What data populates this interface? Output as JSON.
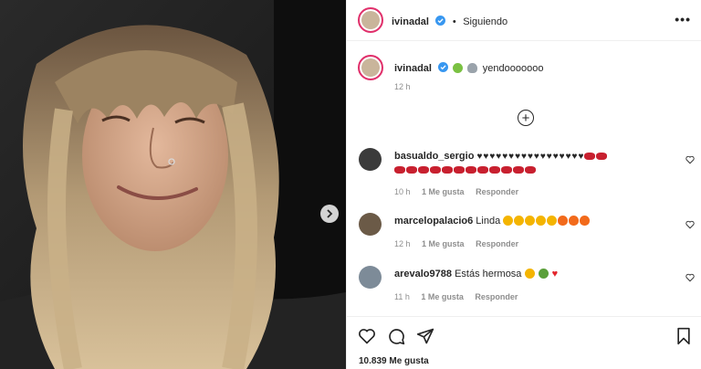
{
  "post": {
    "username": "ivinadal",
    "follow_status": "Siguiendo",
    "more_label": "•••",
    "caption_text": "yendooooooo",
    "caption_emojis": [
      "alien-emoji",
      "ufo-emoji"
    ],
    "caption_time": "12 h",
    "likes": "10.839 Me gusta"
  },
  "comments": [
    {
      "username": "basualdo_sergio",
      "line1_hearts": 17,
      "line1_lips": 2,
      "line2_lips": 12,
      "time": "10 h",
      "likes": "1 Me gusta",
      "reply": "Responder"
    },
    {
      "username": "marcelopalacio6",
      "text": "Linda",
      "stars": 5,
      "fires": 3,
      "time": "12 h",
      "likes": "1 Me gusta",
      "reply": "Responder"
    },
    {
      "username": "arevalo9788",
      "text": "Estás hermosa",
      "emojis": [
        "heart-eyes-emoji",
        "broccoli-emoji",
        "red-heart-emoji"
      ],
      "time": "11 h",
      "likes": "1 Me gusta",
      "reply": "Responder"
    }
  ],
  "icons": {
    "verified_color": "#3897f0",
    "story_ring_color": "#e1306c"
  }
}
